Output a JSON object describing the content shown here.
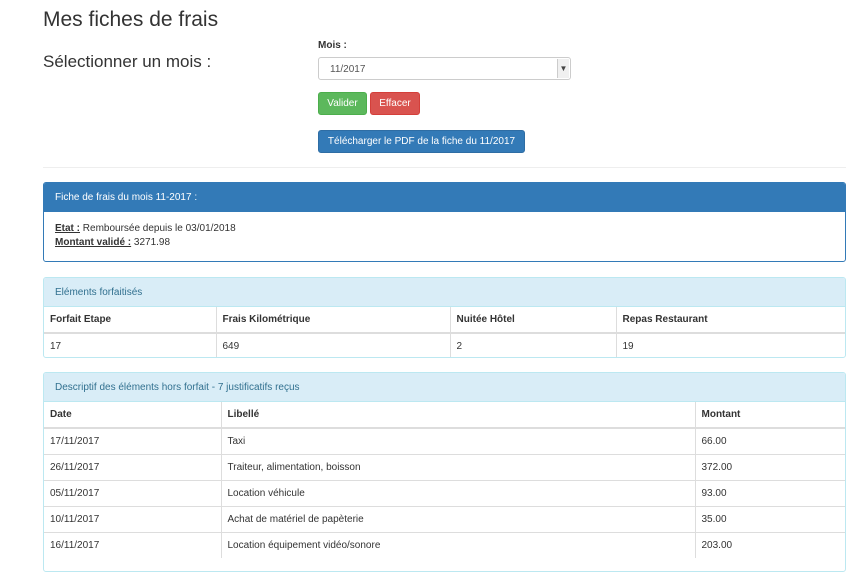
{
  "header": {
    "title": "Mes fiches de frais",
    "select_label": "Sélectionner un mois :"
  },
  "form": {
    "mois_label": "Mois :",
    "mois_value": "11/2017",
    "valider_label": "Valider",
    "effacer_label": "Effacer",
    "pdf_label": "Télécharger le PDF de la fiche du 11/2017"
  },
  "fiche": {
    "heading": "Fiche de frais du mois 11-2017 :",
    "etat_label": "Etat :",
    "etat_value": "Remboursée depuis le 03/01/2018",
    "montant_label": "Montant validé :",
    "montant_value": "3271.98"
  },
  "forfait": {
    "heading": "Eléments forfaitisés",
    "columns": [
      "Forfait Etape",
      "Frais Kilométrique",
      "Nuitée Hôtel",
      "Repas Restaurant"
    ],
    "values": [
      "17",
      "649",
      "2",
      "19"
    ]
  },
  "hors_forfait": {
    "heading": "Descriptif des éléments hors forfait - 7 justificatifs reçus",
    "columns": [
      "Date",
      "Libellé",
      "Montant"
    ],
    "rows": [
      [
        "17/11/2017",
        "Taxi",
        "66.00"
      ],
      [
        "26/11/2017",
        "Traiteur, alimentation, boisson",
        "372.00"
      ],
      [
        "05/11/2017",
        "Location véhicule",
        "93.00"
      ],
      [
        "10/11/2017",
        "Achat de matériel de papèterie",
        "35.00"
      ],
      [
        "16/11/2017",
        "Location équipement vidéo/sonore",
        "203.00"
      ]
    ]
  },
  "colors": {
    "primary": "#337ab7",
    "success": "#5cb85c",
    "danger": "#d9534f",
    "info_bg": "#d9edf7"
  }
}
